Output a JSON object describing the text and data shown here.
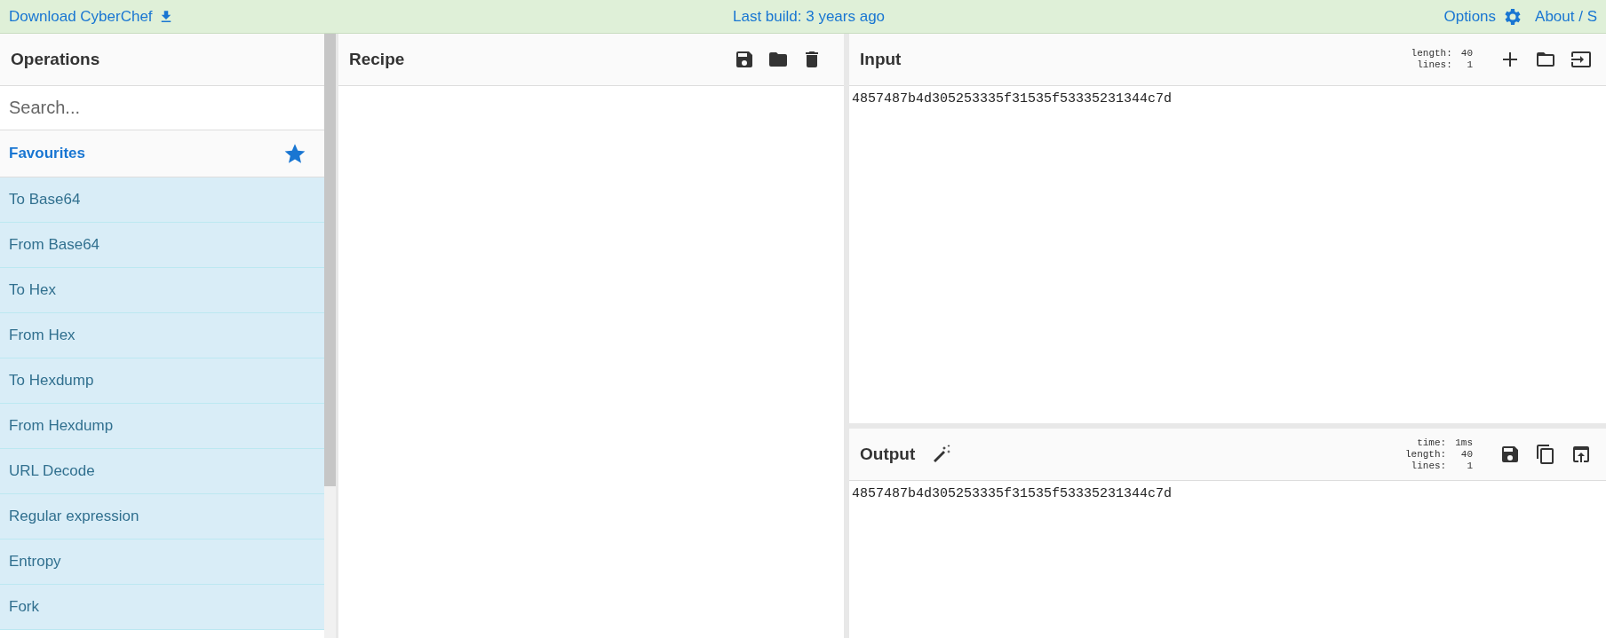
{
  "top_bar": {
    "download_link": "Download CyberChef",
    "build_info": "Last build: 3 years ago",
    "options": "Options",
    "about": "About / S"
  },
  "operations": {
    "title": "Operations",
    "search": {
      "placeholder": "Search..."
    },
    "category": "Favourites",
    "items": [
      "To Base64",
      "From Base64",
      "To Hex",
      "From Hex",
      "To Hexdump",
      "From Hexdump",
      "URL Decode",
      "Regular expression",
      "Entropy",
      "Fork"
    ]
  },
  "recipe": {
    "title": "Recipe"
  },
  "input": {
    "title": "Input",
    "stats": [
      {
        "label": "length:",
        "value": "40"
      },
      {
        "label": "lines:",
        "value": "1"
      }
    ],
    "text": "4857487b4d305253335f31535f53335231344c7d"
  },
  "output": {
    "title": "Output",
    "stats": [
      {
        "label": "time:",
        "value": "1ms"
      },
      {
        "label": "length:",
        "value": "40"
      },
      {
        "label": "lines:",
        "value": "1"
      }
    ],
    "text": "4857487b4d305253335f31535f53335231344c7d"
  }
}
